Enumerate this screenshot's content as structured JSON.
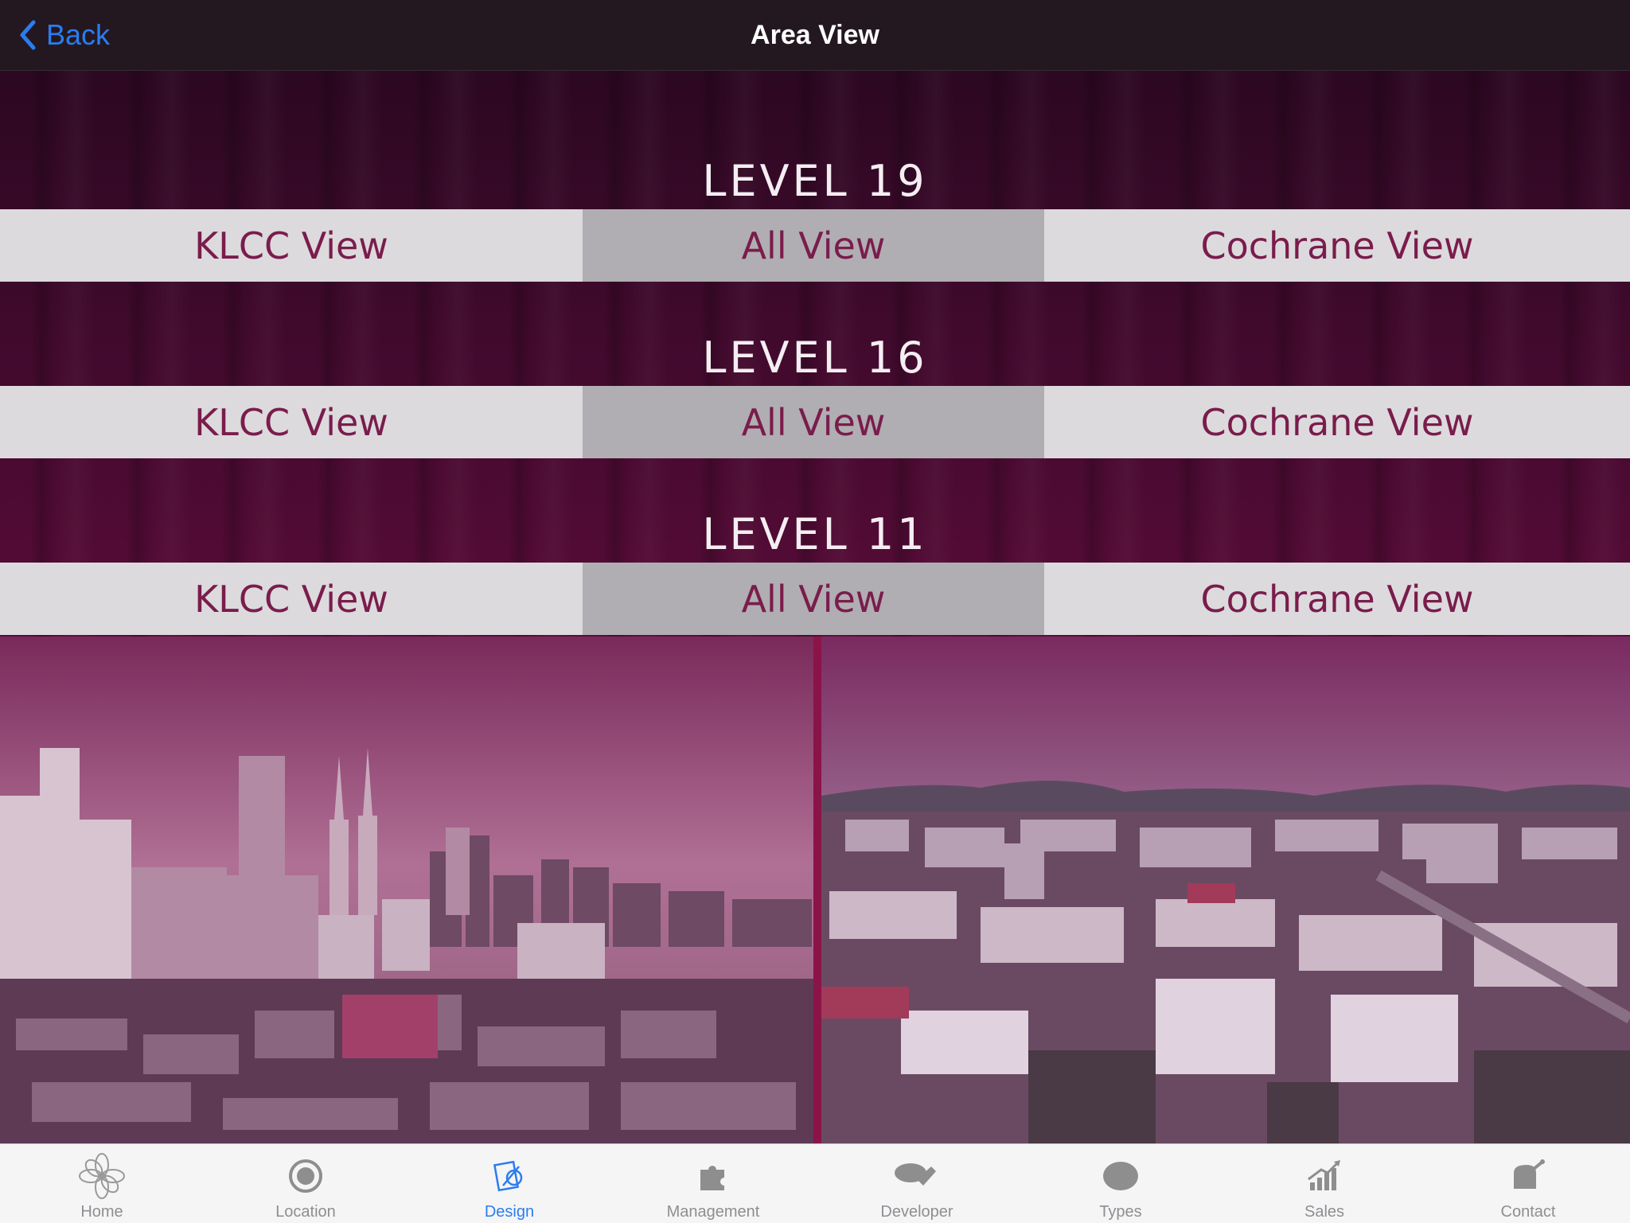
{
  "nav": {
    "back_label": "Back",
    "title": "Area View"
  },
  "levels": [
    {
      "title": "LEVEL 19",
      "views": [
        "KLCC View",
        "All View",
        "Cochrane View"
      ]
    },
    {
      "title": "LEVEL 16",
      "views": [
        "KLCC View",
        "All View",
        "Cochrane View"
      ]
    },
    {
      "title": "LEVEL 11",
      "views": [
        "KLCC View",
        "All View",
        "Cochrane View"
      ]
    }
  ],
  "tabs": [
    {
      "label": "Home",
      "icon": "flower-icon"
    },
    {
      "label": "Location",
      "icon": "target-icon"
    },
    {
      "label": "Design",
      "icon": "design-icon",
      "active": true
    },
    {
      "label": "Management",
      "icon": "puzzle-icon"
    },
    {
      "label": "Developer",
      "icon": "handshake-icon"
    },
    {
      "label": "Types",
      "icon": "oval-icon"
    },
    {
      "label": "Sales",
      "icon": "chart-icon"
    },
    {
      "label": "Contact",
      "icon": "contact-icon"
    }
  ],
  "colors": {
    "accent": "#2a7df0",
    "view_text": "#7a1c4c",
    "divider": "#8a1448"
  }
}
